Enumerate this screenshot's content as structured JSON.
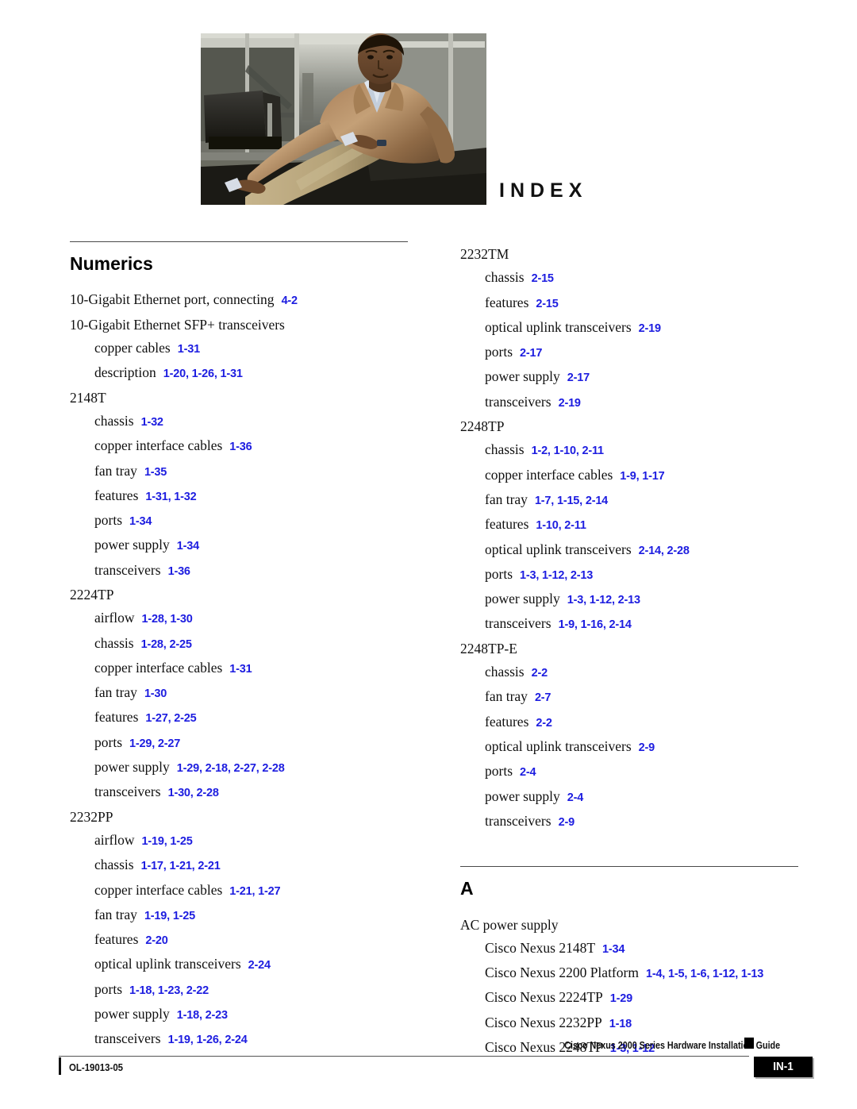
{
  "page": {
    "title": "INDEX"
  },
  "header_photo": {
    "alt": "photo-seated-man-tan-jacket"
  },
  "columns": [
    {
      "id": "left",
      "sections": [
        {
          "heading": "Numerics",
          "entries": [
            {
              "level": 1,
              "term": "10-Gigabit Ethernet port, connecting",
              "refs": "4-2"
            },
            {
              "level": 1,
              "term": "10-Gigabit Ethernet SFP+ transceivers",
              "refs": ""
            },
            {
              "level": 2,
              "term": "copper cables",
              "refs": "1-31"
            },
            {
              "level": 2,
              "term": "description",
              "refs": "1-20, 1-26, 1-31"
            },
            {
              "level": 1,
              "term": "2148T",
              "refs": ""
            },
            {
              "level": 2,
              "term": "chassis",
              "refs": "1-32"
            },
            {
              "level": 2,
              "term": "copper interface cables",
              "refs": "1-36"
            },
            {
              "level": 2,
              "term": "fan tray",
              "refs": "1-35"
            },
            {
              "level": 2,
              "term": "features",
              "refs": "1-31, 1-32"
            },
            {
              "level": 2,
              "term": "ports",
              "refs": "1-34"
            },
            {
              "level": 2,
              "term": "power supply",
              "refs": "1-34"
            },
            {
              "level": 2,
              "term": "transceivers",
              "refs": "1-36"
            },
            {
              "level": 1,
              "term": "2224TP",
              "refs": ""
            },
            {
              "level": 2,
              "term": "airflow",
              "refs": "1-28, 1-30"
            },
            {
              "level": 2,
              "term": "chassis",
              "refs": "1-28, 2-25"
            },
            {
              "level": 2,
              "term": "copper interface cables",
              "refs": "1-31"
            },
            {
              "level": 2,
              "term": "fan tray",
              "refs": "1-30"
            },
            {
              "level": 2,
              "term": "features",
              "refs": "1-27, 2-25"
            },
            {
              "level": 2,
              "term": "ports",
              "refs": "1-29, 2-27"
            },
            {
              "level": 2,
              "term": "power supply",
              "refs": "1-29, 2-18, 2-27, 2-28"
            },
            {
              "level": 2,
              "term": "transceivers",
              "refs": "1-30, 2-28"
            },
            {
              "level": 1,
              "term": "2232PP",
              "refs": ""
            },
            {
              "level": 2,
              "term": "airflow",
              "refs": "1-19, 1-25"
            },
            {
              "level": 2,
              "term": "chassis",
              "refs": "1-17, 1-21, 2-21"
            },
            {
              "level": 2,
              "term": "copper interface cables",
              "refs": "1-21, 1-27"
            },
            {
              "level": 2,
              "term": "fan tray",
              "refs": "1-19, 1-25"
            },
            {
              "level": 2,
              "term": "features",
              "refs": "2-20"
            },
            {
              "level": 2,
              "term": "optical uplink transceivers",
              "refs": "2-24"
            },
            {
              "level": 2,
              "term": "ports",
              "refs": "1-18, 1-23, 2-22"
            },
            {
              "level": 2,
              "term": "power supply",
              "refs": "1-18, 2-23"
            },
            {
              "level": 2,
              "term": "transceivers",
              "refs": "1-19, 1-26, 2-24"
            }
          ]
        }
      ]
    },
    {
      "id": "right",
      "sections": [
        {
          "heading": "",
          "entries": [
            {
              "level": 1,
              "term": "2232TM",
              "refs": ""
            },
            {
              "level": 2,
              "term": "chassis",
              "refs": "2-15"
            },
            {
              "level": 2,
              "term": "features",
              "refs": "2-15"
            },
            {
              "level": 2,
              "term": "optical uplink transceivers",
              "refs": "2-19"
            },
            {
              "level": 2,
              "term": "ports",
              "refs": "2-17"
            },
            {
              "level": 2,
              "term": "power supply",
              "refs": "2-17"
            },
            {
              "level": 2,
              "term": "transceivers",
              "refs": "2-19"
            },
            {
              "level": 1,
              "term": "2248TP",
              "refs": ""
            },
            {
              "level": 2,
              "term": "chassis",
              "refs": "1-2, 1-10, 2-11"
            },
            {
              "level": 2,
              "term": "copper interface cables",
              "refs": "1-9, 1-17"
            },
            {
              "level": 2,
              "term": "fan tray",
              "refs": "1-7, 1-15, 2-14"
            },
            {
              "level": 2,
              "term": "features",
              "refs": "1-10, 2-11"
            },
            {
              "level": 2,
              "term": "optical uplink transceivers",
              "refs": "2-14, 2-28"
            },
            {
              "level": 2,
              "term": "ports",
              "refs": "1-3, 1-12, 2-13"
            },
            {
              "level": 2,
              "term": "power supply",
              "refs": "1-3, 1-12, 2-13"
            },
            {
              "level": 2,
              "term": "transceivers",
              "refs": "1-9, 1-16, 2-14"
            },
            {
              "level": 1,
              "term": "2248TP-E",
              "refs": ""
            },
            {
              "level": 2,
              "term": "chassis",
              "refs": "2-2"
            },
            {
              "level": 2,
              "term": "fan tray",
              "refs": "2-7"
            },
            {
              "level": 2,
              "term": "features",
              "refs": "2-2"
            },
            {
              "level": 2,
              "term": "optical uplink transceivers",
              "refs": "2-9"
            },
            {
              "level": 2,
              "term": "ports",
              "refs": "2-4"
            },
            {
              "level": 2,
              "term": "power supply",
              "refs": "2-4"
            },
            {
              "level": 2,
              "term": "transceivers",
              "refs": "2-9"
            }
          ]
        },
        {
          "heading": "A",
          "entries": [
            {
              "level": 1,
              "term": "AC power supply",
              "refs": ""
            },
            {
              "level": 2,
              "term": "Cisco Nexus 2148T",
              "refs": "1-34"
            },
            {
              "level": 2,
              "term": "Cisco Nexus 2200 Platform",
              "refs": "1-4, 1-5, 1-6, 1-12, 1-13"
            },
            {
              "level": 2,
              "term": "Cisco Nexus 2224TP",
              "refs": "1-29"
            },
            {
              "level": 2,
              "term": "Cisco Nexus 2232PP",
              "refs": "1-18"
            },
            {
              "level": 2,
              "term": "Cisco Nexus 2248TP",
              "refs": "1-3, 1-12"
            }
          ]
        }
      ]
    }
  ],
  "footer": {
    "guide_title": "Cisco Nexus 2000 Series Hardware Installation Guide",
    "doc_id": "OL-19013-05",
    "page_number": "IN-1"
  },
  "colors": {
    "reference_blue": "#1d1de0",
    "rule_gray": "#4a4a4a",
    "page_box": "#000000"
  }
}
